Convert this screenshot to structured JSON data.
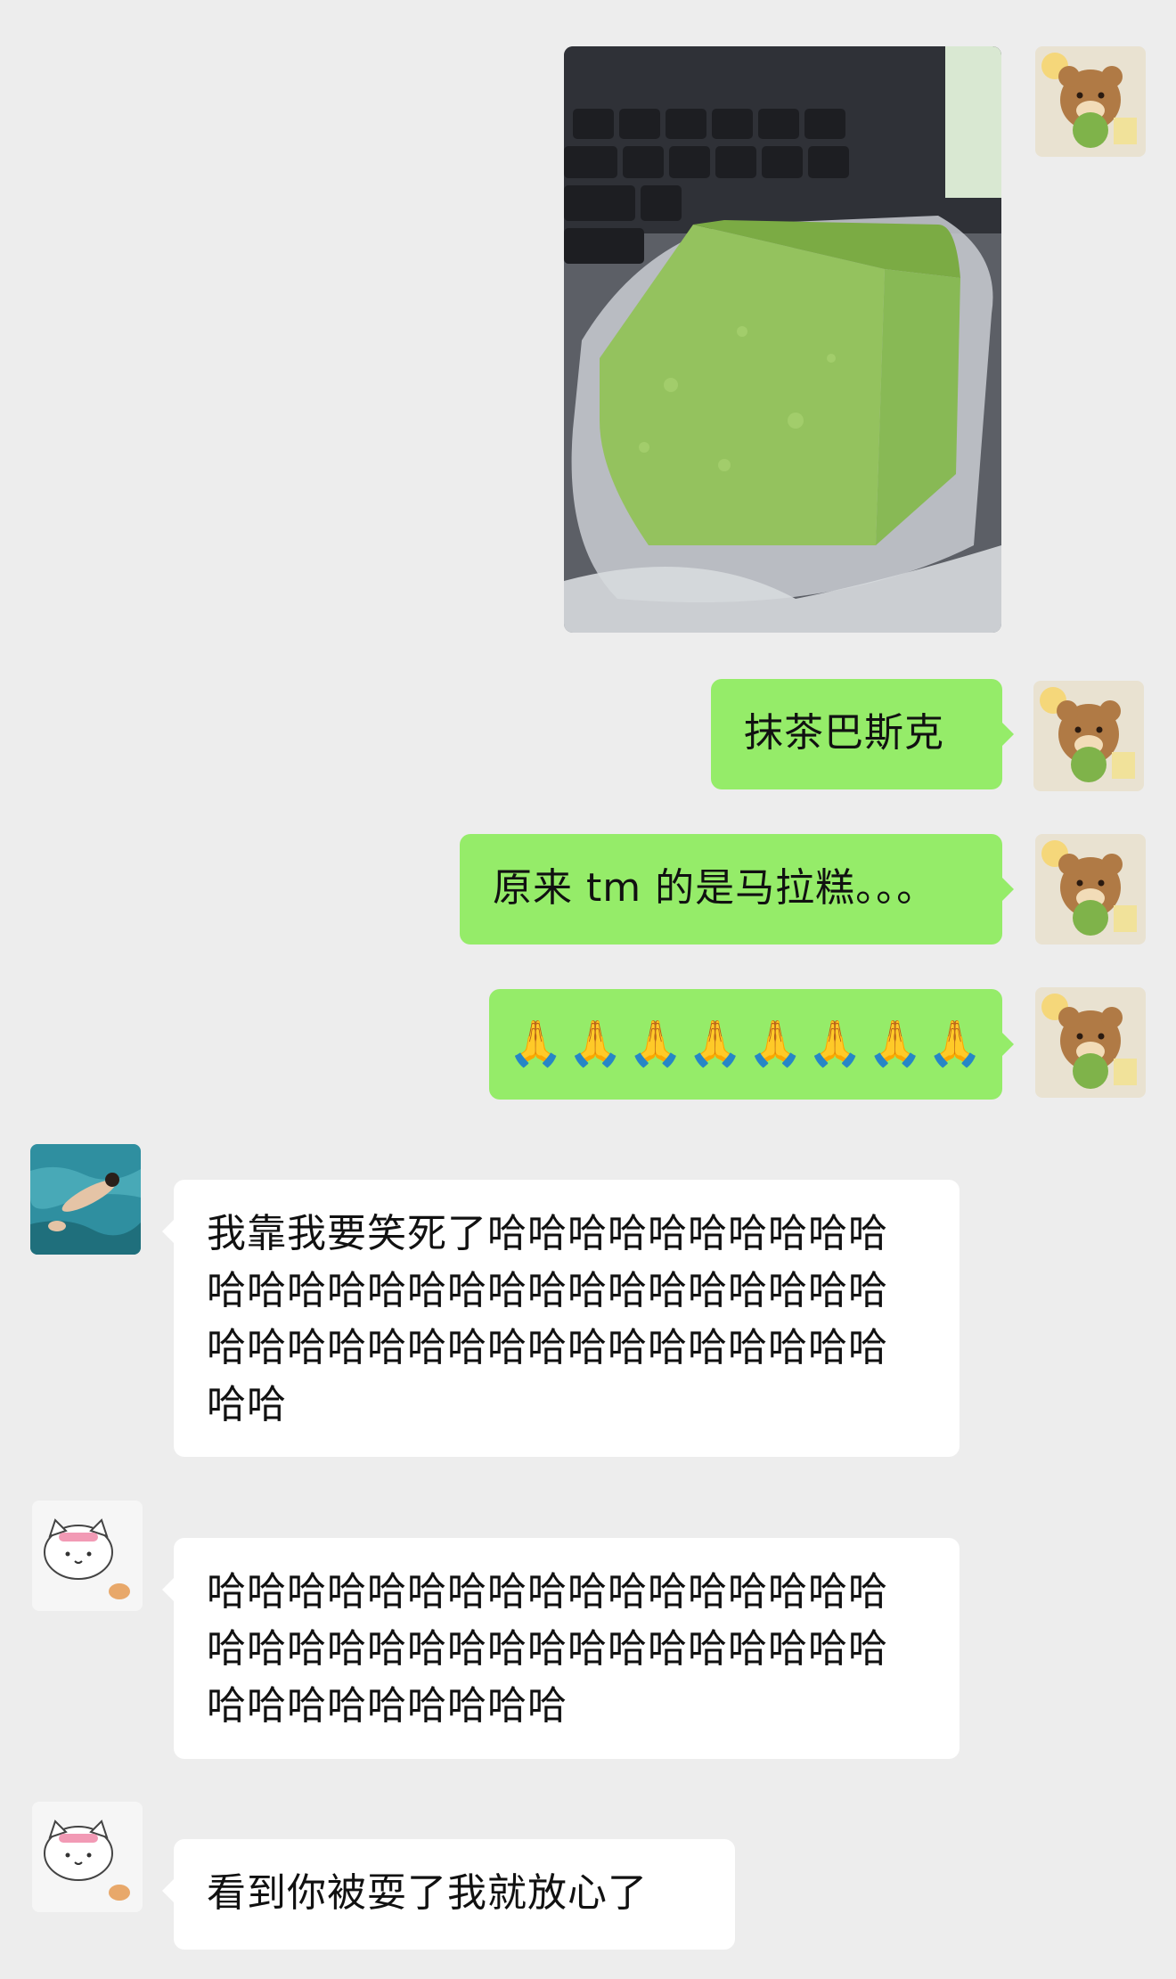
{
  "messages": [
    {
      "id": "m1",
      "side": "out",
      "type": "image",
      "alt": "抹茶巴斯克"
    },
    {
      "id": "m2",
      "side": "out",
      "type": "text",
      "text": "抹茶巴斯克"
    },
    {
      "id": "m3",
      "side": "out",
      "type": "text",
      "text": "原来 tm 的是马拉糕。。。"
    },
    {
      "id": "m4",
      "side": "out",
      "type": "emoji",
      "emoji": [
        "🙏",
        "🙏",
        "🙏",
        "🙏",
        "🙏",
        "🙏",
        "🙏",
        "🙏"
      ]
    },
    {
      "id": "m5",
      "side": "in",
      "type": "text",
      "text": "我靠我要笑死了哈哈哈哈哈哈哈哈哈哈哈哈哈哈哈哈哈哈哈哈哈哈哈哈哈哈哈哈哈哈哈哈哈哈哈哈哈哈哈哈哈哈哈哈哈哈"
    },
    {
      "id": "m6",
      "side": "in",
      "type": "text",
      "text": "哈哈哈哈哈哈哈哈哈哈哈哈哈哈哈哈哈哈哈哈哈哈哈哈哈哈哈哈哈哈哈哈哈哈哈哈哈哈哈哈哈哈哈"
    },
    {
      "id": "m7",
      "side": "in",
      "type": "text",
      "text": "看到你被耍了我就放心了"
    }
  ],
  "colors": {
    "outgoing": "#95ec69",
    "incoming": "#ffffff",
    "background": "#ededed"
  },
  "icons": {
    "self_avatar": "bear-avatar-icon",
    "sender1_avatar": "swimmer-avatar-icon",
    "sender2_avatar": "cat-avatar-icon"
  }
}
